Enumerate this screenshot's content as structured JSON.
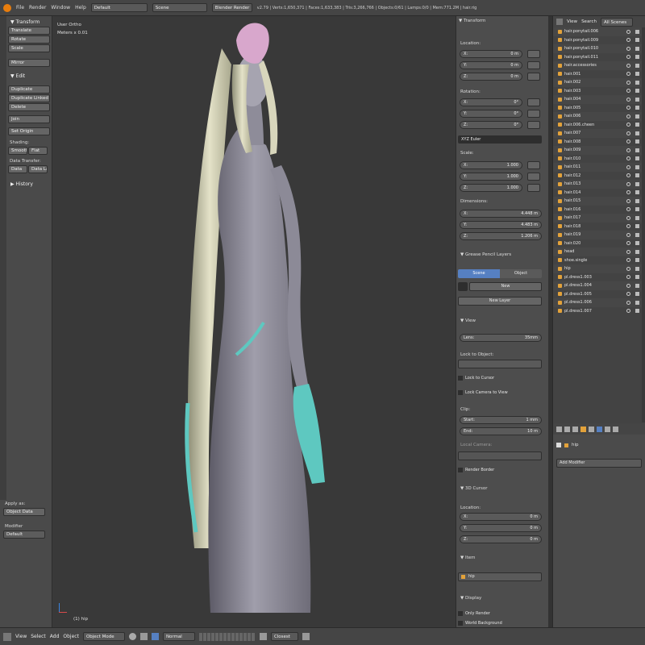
{
  "topbar": {
    "menus": [
      "File",
      "Render",
      "Window",
      "Help"
    ],
    "layout": "Default",
    "scene": "Scene",
    "engine": "Blender Render",
    "info": "v2.79 | Verts:1,650,371 | Faces:1,633,383 | Tris:3,266,766 | Objects:0/61 | Lamps:0/0 | Mem:771.2M | hair.rig"
  },
  "toolshelf": {
    "transform_header": "Transform",
    "transform_buttons": [
      "Translate",
      "Rotate",
      "Scale"
    ],
    "mirror": "Mirror",
    "edit_header": "Edit",
    "edit_buttons": [
      "Duplicate",
      "Duplicate Linked",
      "Delete",
      "Join"
    ],
    "set_origin": "Set Origin",
    "shading_label": "Shading:",
    "smooth": "Smooth",
    "flat": "Flat",
    "data_transfer_label": "Data Transfer:",
    "data": "Data",
    "data_lay": "Data Lay",
    "history_header": "History",
    "apply_as_label": "Apply as:",
    "apply_as_value": "Object Data",
    "modifier_label": "Modifier",
    "modifier_value": "Default"
  },
  "viewport": {
    "view_name": "User Ortho",
    "units": "Meters x 0.01",
    "scale_text": "(1) hip"
  },
  "properties": {
    "transform_header": "Transform",
    "location_label": "Location:",
    "location": [
      {
        "axis": "X:",
        "value": "0 m"
      },
      {
        "axis": "Y:",
        "value": "0 m"
      },
      {
        "axis": "Z:",
        "value": "0 m"
      }
    ],
    "rotation_label": "Rotation:",
    "rotation": [
      {
        "axis": "X:",
        "value": "0°"
      },
      {
        "axis": "Y:",
        "value": "0°"
      },
      {
        "axis": "Z:",
        "value": "0°"
      }
    ],
    "rotation_mode": "XYZ Euler",
    "scale_label": "Scale:",
    "scale": [
      {
        "axis": "X:",
        "value": "1.000"
      },
      {
        "axis": "Y:",
        "value": "1.000"
      },
      {
        "axis": "Z:",
        "value": "1.000"
      }
    ],
    "dimensions_label": "Dimensions:",
    "dimensions": [
      {
        "axis": "X:",
        "value": "4.448 m"
      },
      {
        "axis": "Y:",
        "value": "4.483 m"
      },
      {
        "axis": "Z:",
        "value": "1.206 m"
      }
    ],
    "grease_pencil": "Grease Pencil Layers",
    "scene_tab": "Scene",
    "object_tab": "Object",
    "new_btn": "New",
    "new_layer_btn": "New Layer",
    "view_header": "View",
    "lens_label": "Lens:",
    "lens_value": "35mm",
    "lock_to_object": "Lock to Object:",
    "lock_to_cursor": "Lock to Cursor",
    "lock_camera": "Lock Camera to View",
    "clip_label": "Clip:",
    "clip_start_label": "Start:",
    "clip_start": "1 mm",
    "clip_end_label": "End:",
    "clip_end": "10 m",
    "local_camera": "Local Camera:",
    "render_border": "Render Border",
    "cursor_header": "3D Cursor",
    "cursor_location_label": "Location:",
    "cursor_location": [
      {
        "axis": "X:",
        "value": "0 m"
      },
      {
        "axis": "Y:",
        "value": "0 m"
      },
      {
        "axis": "Z:",
        "value": "0 m"
      }
    ],
    "item_header": "Item",
    "item_name": "hip",
    "display_header": "Display",
    "only_render": "Only Render",
    "world_background": "World Background"
  },
  "outliner": {
    "view": "View",
    "search": "Search",
    "filter": "All Scenes",
    "items": [
      "hair.ponytail.006",
      "hair.ponytail.009",
      "hair.ponytail.010",
      "hair.ponytail.011",
      "hair.accessories",
      "hair.001",
      "hair.002",
      "hair.003",
      "hair.004",
      "hair.005",
      "hair.006",
      "hair.006.cheen",
      "hair.007",
      "hair.008",
      "hair.009",
      "hair.010",
      "hair.011",
      "hair.012",
      "hair.013",
      "hair.014",
      "hair.015",
      "hair.016",
      "hair.017",
      "hair.018",
      "hair.019",
      "hair.020",
      "head",
      "shoe.single",
      "hip",
      "pl.dress1.003",
      "pl.dress1.004",
      "pl.dress1.005",
      "pl.dress1.006",
      "pl.dress1.007"
    ]
  },
  "modifier_panel": {
    "object_name": "hip",
    "add_modifier": "Add Modifier"
  },
  "bottombar": {
    "menus": [
      "View",
      "Select",
      "Add",
      "Object"
    ],
    "mode": "Object Mode",
    "pivot": "Normal",
    "snap": "Closest"
  },
  "colors": {
    "accent": "#5680c2",
    "background": "#393939",
    "panel": "#4d4d4d"
  }
}
